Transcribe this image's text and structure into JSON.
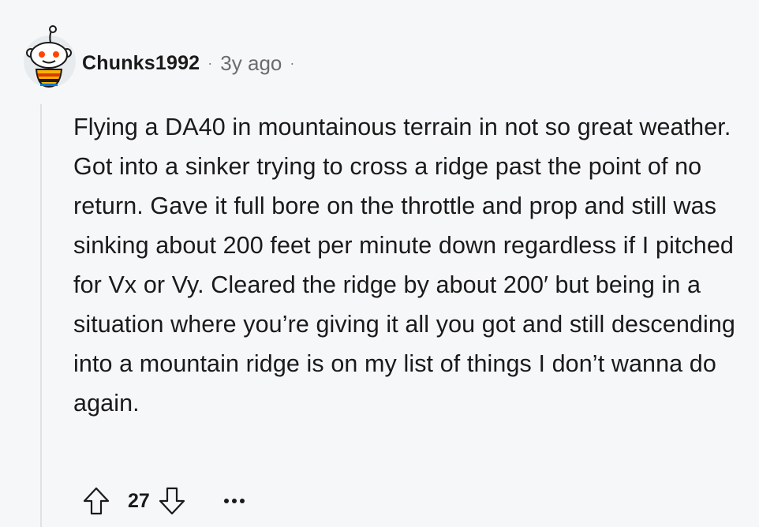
{
  "comment": {
    "username": "Chunks1992",
    "separator": "·",
    "age": "3y ago",
    "age_separator": "·",
    "body": "Flying a DA40 in mountainous terrain in not so great weather. Got into a sinker trying to cross a ridge past the point of no return. Gave it full bore on the throttle and prop and still was sinking about 200 feet per minute down regardless if I pitched for Vx or Vy. Cleared the ridge by about 200′ but being in a situation where you’re giving it all you got and still descending into a mountain ridge is on my list of things I don’t wanna do again.",
    "score": "27"
  },
  "icons": {
    "avatar": "snoo-avatar",
    "upvote": "upvote-arrow-icon",
    "downvote": "downvote-arrow-icon",
    "more": "more-options-icon"
  },
  "colors": {
    "background": "#f6f7f8",
    "text": "#1a1a1b",
    "meta": "#6a6d70",
    "thread_line": "#dfe1e3",
    "avatar_bg": "#e8ebee"
  }
}
